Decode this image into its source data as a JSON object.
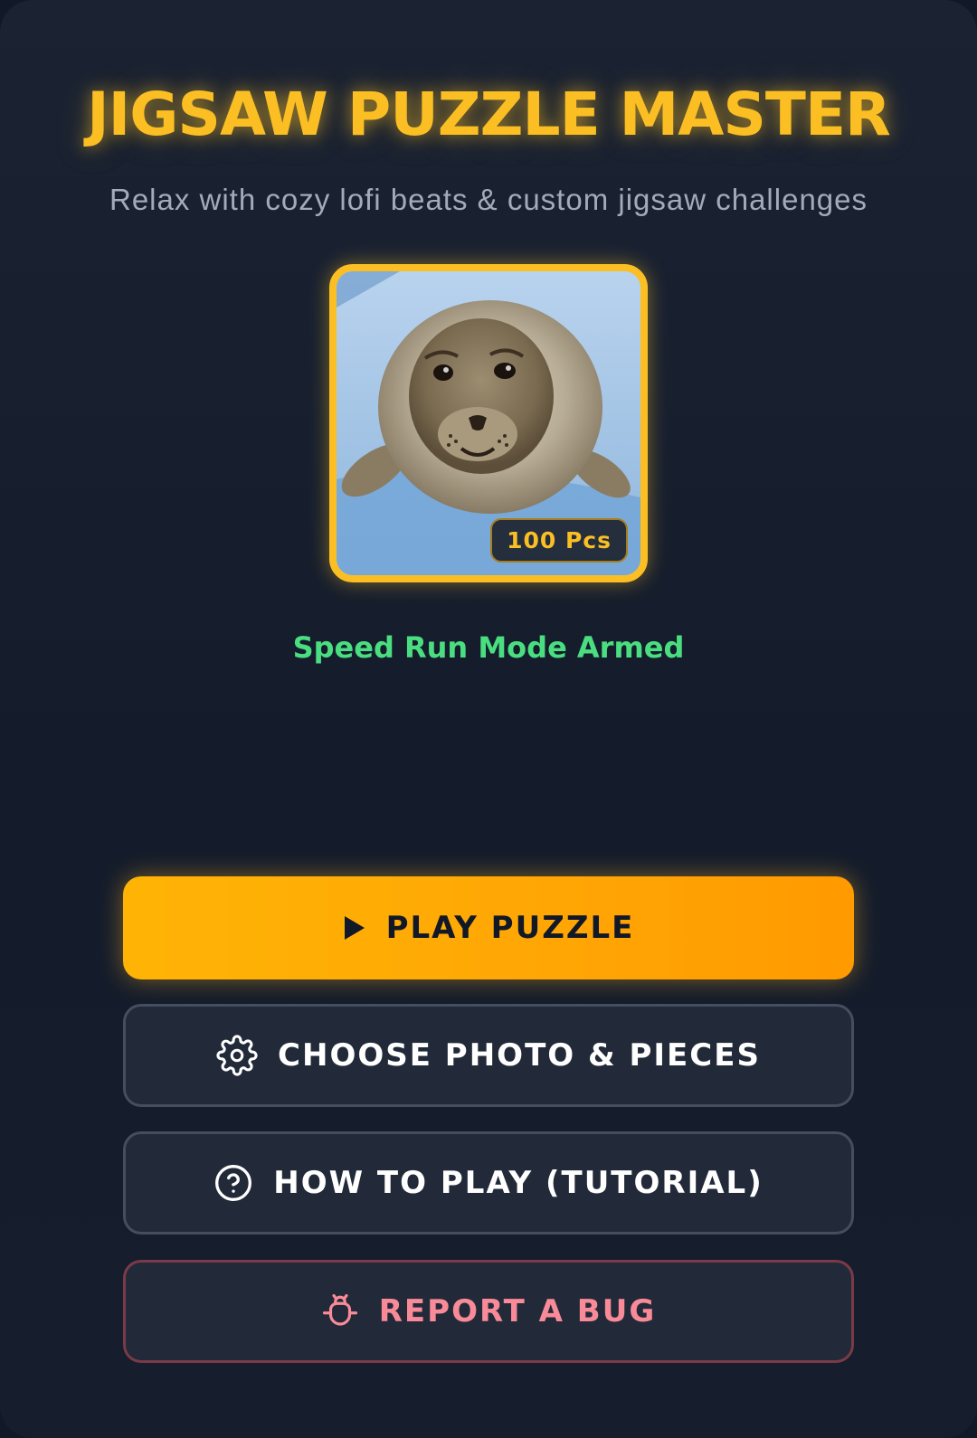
{
  "header": {
    "title": "JIGSAW PUZZLE MASTER",
    "subtitle": "Relax with cozy lofi beats & custom jigsaw challenges"
  },
  "preview": {
    "image_subject": "seal",
    "pieces_badge": "100 Pcs"
  },
  "status": {
    "mode_text": "Speed Run Mode Armed"
  },
  "buttons": {
    "play": {
      "label": "PLAY PUZZLE",
      "icon": "play-icon"
    },
    "choose": {
      "label": "CHOOSE PHOTO & PIECES",
      "icon": "gear-icon"
    },
    "tutorial": {
      "label": "HOW TO PLAY (TUTORIAL)",
      "icon": "help-circle-icon"
    },
    "bug": {
      "label": "REPORT A BUG",
      "icon": "bug-icon"
    }
  },
  "colors": {
    "accent": "#fbbf24",
    "status_green": "#4ade80",
    "bug_pink": "#f98b99",
    "background": "#1b2333"
  }
}
